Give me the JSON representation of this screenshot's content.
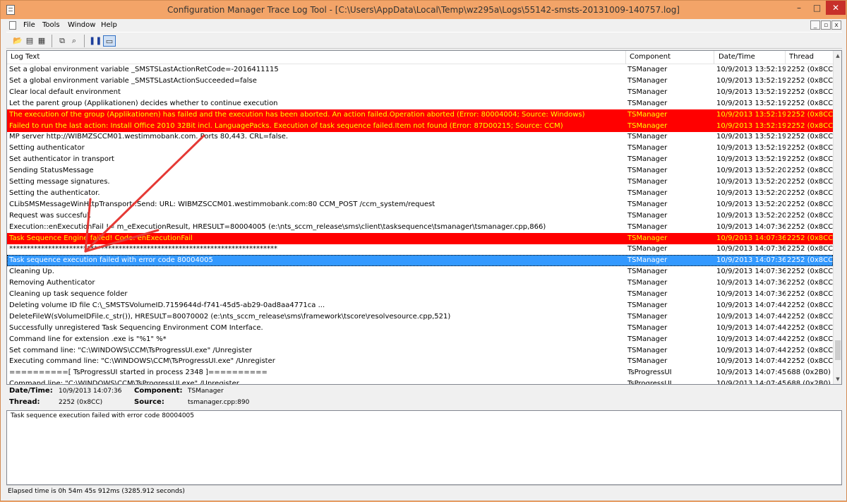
{
  "window": {
    "title": "Configuration Manager Trace Log Tool - [C:\\Users\\AppData\\Local\\Temp\\wz295a\\Logs\\55142-smsts-20131009-140757.log]",
    "min_glyph": "–",
    "max_glyph": "□",
    "close_glyph": "✕"
  },
  "menu": {
    "items": [
      "File",
      "Tools",
      "Window",
      "Help"
    ],
    "mdi_min": "_",
    "mdi_restore": "▫",
    "mdi_close": "x"
  },
  "toolbar": {
    "open_glyph": "📂",
    "print_preview_glyph": "▤",
    "print_glyph": "▦",
    "copy_glyph": "⧉",
    "find_glyph": "⌕",
    "pause_glyph": "❚❚",
    "view_glyph": "▭"
  },
  "grid": {
    "columns": [
      "Log Text",
      "Component",
      "Date/Time",
      "Thread"
    ],
    "rows": [
      {
        "text": "Set a global environment variable _SMSTSLastActionRetCode=-2016411115",
        "component": "TSManager",
        "datetime": "10/9/2013 13:52:19",
        "thread": "2252 (0x8CC)",
        "style": "normal"
      },
      {
        "text": "Set a global environment variable _SMSTSLastActionSucceeded=false",
        "component": "TSManager",
        "datetime": "10/9/2013 13:52:19",
        "thread": "2252 (0x8CC)",
        "style": "normal"
      },
      {
        "text": "Clear local default environment",
        "component": "TSManager",
        "datetime": "10/9/2013 13:52:19",
        "thread": "2252 (0x8CC)",
        "style": "normal"
      },
      {
        "text": "Let the parent group (Applikationen) decides whether to continue execution",
        "component": "TSManager",
        "datetime": "10/9/2013 13:52:19",
        "thread": "2252 (0x8CC)",
        "style": "normal"
      },
      {
        "text": "The execution of the group (Applikationen) has failed and the execution has been aborted. An action failed.Operation aborted (Error: 80004004; Source: Windows)",
        "component": "TSManager",
        "datetime": "10/9/2013 13:52:19",
        "thread": "2252 (0x8CC)",
        "style": "error"
      },
      {
        "text": "Failed to run the last action: Install Office 2010 32Bit incl. LanguagePacks. Execution of task sequence failed.Item not found (Error: 87D00215; Source: CCM)",
        "component": "TSManager",
        "datetime": "10/9/2013 13:52:19",
        "thread": "2252 (0x8CC)",
        "style": "error"
      },
      {
        "text": "MP server http://WIBMZSCCM01.westimmobank.com. Ports 80,443. CRL=false.",
        "component": "TSManager",
        "datetime": "10/9/2013 13:52:19",
        "thread": "2252 (0x8CC)",
        "style": "normal"
      },
      {
        "text": "Setting authenticator",
        "component": "TSManager",
        "datetime": "10/9/2013 13:52:19",
        "thread": "2252 (0x8CC)",
        "style": "normal"
      },
      {
        "text": "Set authenticator in transport",
        "component": "TSManager",
        "datetime": "10/9/2013 13:52:19",
        "thread": "2252 (0x8CC)",
        "style": "normal"
      },
      {
        "text": "Sending StatusMessage",
        "component": "TSManager",
        "datetime": "10/9/2013 13:52:20",
        "thread": "2252 (0x8CC)",
        "style": "normal"
      },
      {
        "text": "Setting message signatures.",
        "component": "TSManager",
        "datetime": "10/9/2013 13:52:20",
        "thread": "2252 (0x8CC)",
        "style": "normal"
      },
      {
        "text": "Setting the authenticator.",
        "component": "TSManager",
        "datetime": "10/9/2013 13:52:20",
        "thread": "2252 (0x8CC)",
        "style": "normal"
      },
      {
        "text": "CLibSMSMessageWinHttpTransport::Send: URL: WIBMZSCCM01.westimmobank.com:80  CCM_POST /ccm_system/request",
        "component": "TSManager",
        "datetime": "10/9/2013 13:52:20",
        "thread": "2252 (0x8CC)",
        "style": "normal"
      },
      {
        "text": "Request was succesful.",
        "component": "TSManager",
        "datetime": "10/9/2013 13:52:20",
        "thread": "2252 (0x8CC)",
        "style": "normal"
      },
      {
        "text": "Execution::enExecutionFail != m_eExecutionResult, HRESULT=80004005 (e:\\nts_sccm_release\\sms\\client\\tasksequence\\tsmanager\\tsmanager.cpp,866)",
        "component": "TSManager",
        "datetime": "10/9/2013 14:07:36",
        "thread": "2252 (0x8CC)",
        "style": "normal"
      },
      {
        "text": "Task Sequence Engine failed! Code: enExecutionFail",
        "component": "TSManager",
        "datetime": "10/9/2013 14:07:36",
        "thread": "2252 (0x8CC)",
        "style": "error"
      },
      {
        "text": "****************************************************************************",
        "component": "TSManager",
        "datetime": "10/9/2013 14:07:36",
        "thread": "2252 (0x8CC)",
        "style": "normal"
      },
      {
        "text": "Task sequence execution failed with error code 80004005",
        "component": "TSManager",
        "datetime": "10/9/2013 14:07:36",
        "thread": "2252 (0x8CC)",
        "style": "selected"
      },
      {
        "text": "Cleaning Up.",
        "component": "TSManager",
        "datetime": "10/9/2013 14:07:36",
        "thread": "2252 (0x8CC)",
        "style": "normal"
      },
      {
        "text": "Removing Authenticator",
        "component": "TSManager",
        "datetime": "10/9/2013 14:07:36",
        "thread": "2252 (0x8CC)",
        "style": "normal"
      },
      {
        "text": "Cleaning up task sequence folder",
        "component": "TSManager",
        "datetime": "10/9/2013 14:07:36",
        "thread": "2252 (0x8CC)",
        "style": "normal"
      },
      {
        "text": "Deleting volume ID file C:\\_SMSTSVolumeID.7159644d-f741-45d5-ab29-0ad8aa4771ca ...",
        "component": "TSManager",
        "datetime": "10/9/2013 14:07:44",
        "thread": "2252 (0x8CC)",
        "style": "normal"
      },
      {
        "text": "DeleteFileW(sVolumeIDFile.c_str()), HRESULT=80070002 (e:\\nts_sccm_release\\sms\\framework\\tscore\\resolvesource.cpp,521)",
        "component": "TSManager",
        "datetime": "10/9/2013 14:07:44",
        "thread": "2252 (0x8CC)",
        "style": "normal"
      },
      {
        "text": "Successfully unregistered Task Sequencing Environment COM Interface.",
        "component": "TSManager",
        "datetime": "10/9/2013 14:07:44",
        "thread": "2252 (0x8CC)",
        "style": "normal"
      },
      {
        "text": "Command line for extension .exe is \"%1\" %*",
        "component": "TSManager",
        "datetime": "10/9/2013 14:07:44",
        "thread": "2252 (0x8CC)",
        "style": "normal"
      },
      {
        "text": "Set command line: \"C:\\WINDOWS\\CCM\\TsProgressUI.exe\" /Unregister",
        "component": "TSManager",
        "datetime": "10/9/2013 14:07:44",
        "thread": "2252 (0x8CC)",
        "style": "normal"
      },
      {
        "text": "Executing command line: \"C:\\WINDOWS\\CCM\\TsProgressUI.exe\" /Unregister",
        "component": "TSManager",
        "datetime": "10/9/2013 14:07:44",
        "thread": "2252 (0x8CC)",
        "style": "normal"
      },
      {
        "text": "==========[ TsProgressUI started in process 2348 ]==========",
        "component": "TsProgressUI",
        "datetime": "10/9/2013 14:07:45",
        "thread": "688 (0x2B0)",
        "style": "normal"
      },
      {
        "text": "Command line: \"C:\\WINDOWS\\CCM\\TsProgressUI.exe\" /Unregister",
        "component": "TsProgressUI",
        "datetime": "10/9/2013 14:07:45",
        "thread": "688 (0x2B0)",
        "style": "normal"
      }
    ]
  },
  "detail": {
    "datetime_label": "Date/Time:",
    "datetime_value": "10/9/2013 14:07:36",
    "component_label": "Component:",
    "component_value": "TSManager",
    "thread_label": "Thread:",
    "thread_value": "2252 (0x8CC)",
    "source_label": "Source:",
    "source_value": "tsmanager.cpp:890",
    "message": "Task sequence execution failed with error code 80004005"
  },
  "status": {
    "text": "Elapsed time is 0h 54m 45s 912ms (3285.912 seconds)"
  },
  "colors": {
    "title_bar": "#f3a468",
    "error_row_bg": "#ff0000",
    "error_row_text": "#ffff00",
    "selected_row_bg": "#3399ff",
    "annotation_arrow": "#e53935"
  }
}
